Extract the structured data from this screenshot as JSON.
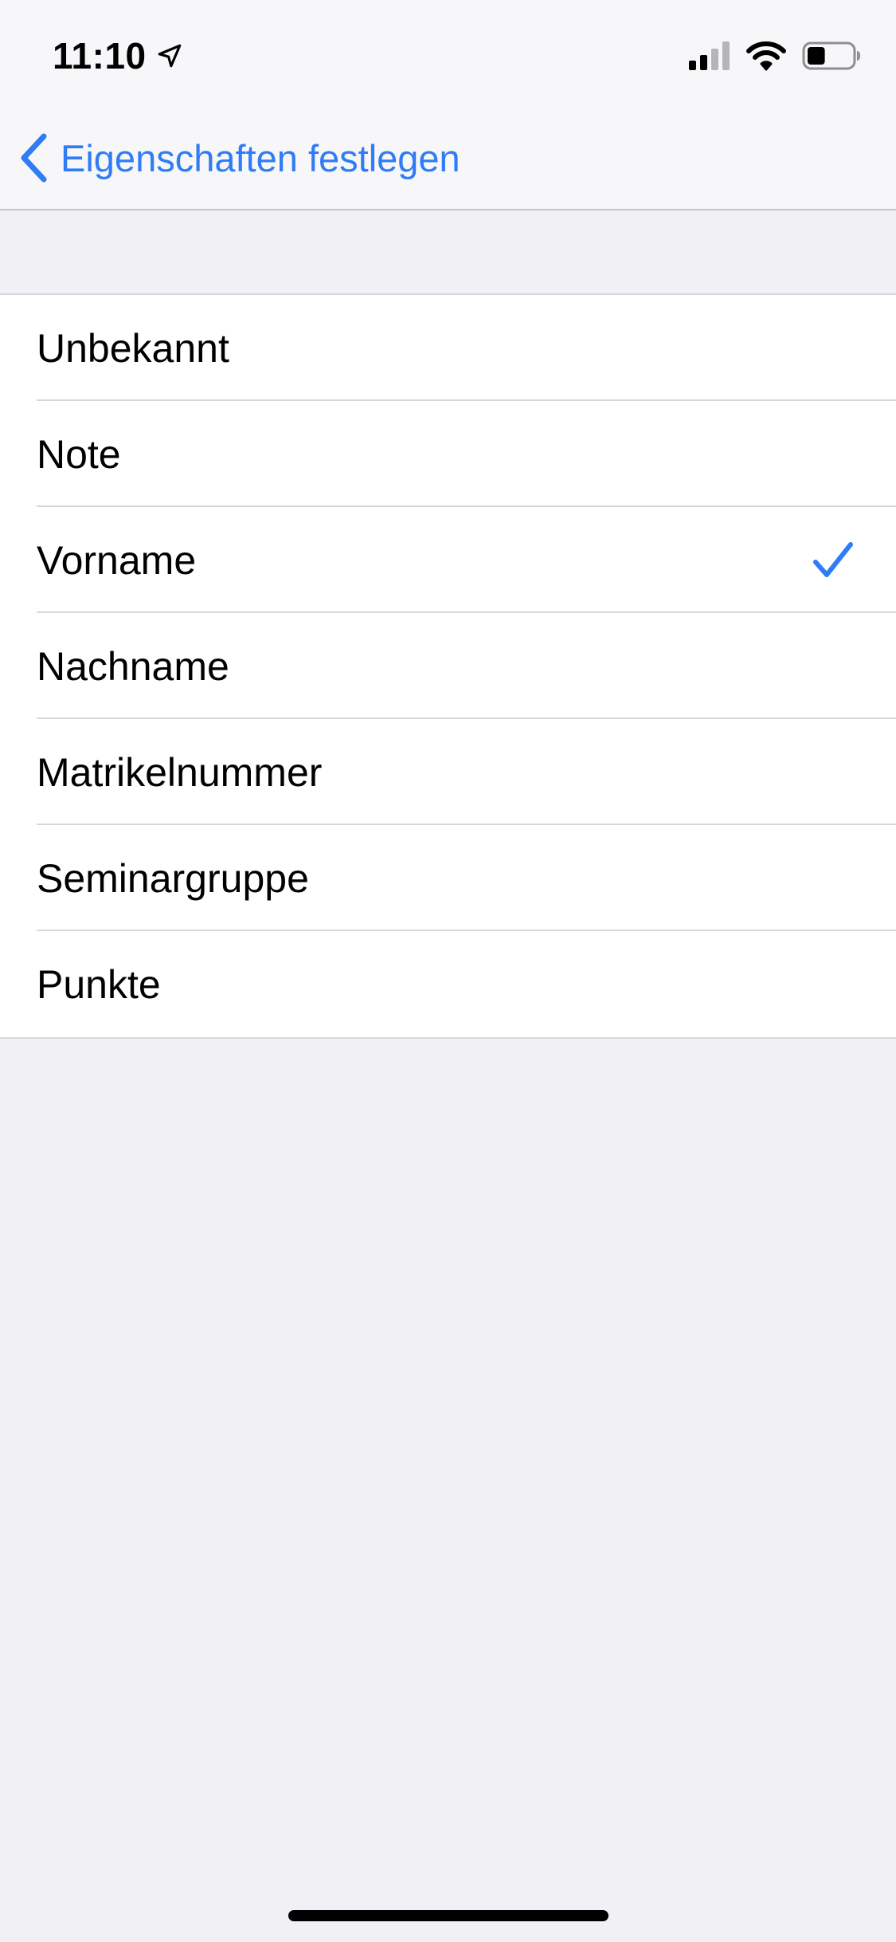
{
  "status_bar": {
    "time": "11:10",
    "location_icon": "location-arrow-icon",
    "signal_icon": "cellular-signal-icon",
    "wifi_icon": "wifi-icon",
    "battery_icon": "battery-icon",
    "battery_level": 0.4
  },
  "nav": {
    "back_label": "Eigenschaften festlegen",
    "back_icon": "chevron-left-icon"
  },
  "options": [
    {
      "label": "Unbekannt",
      "selected": false
    },
    {
      "label": "Note",
      "selected": false
    },
    {
      "label": "Vorname",
      "selected": true
    },
    {
      "label": "Nachname",
      "selected": false
    },
    {
      "label": "Matrikelnummer",
      "selected": false
    },
    {
      "label": "Seminargruppe",
      "selected": false
    },
    {
      "label": "Punkte",
      "selected": false
    }
  ],
  "colors": {
    "accent": "#2f7cf6",
    "background": "#f0f0f5",
    "bar_background": "#f7f7f9",
    "separator": "#d8d8dc"
  }
}
